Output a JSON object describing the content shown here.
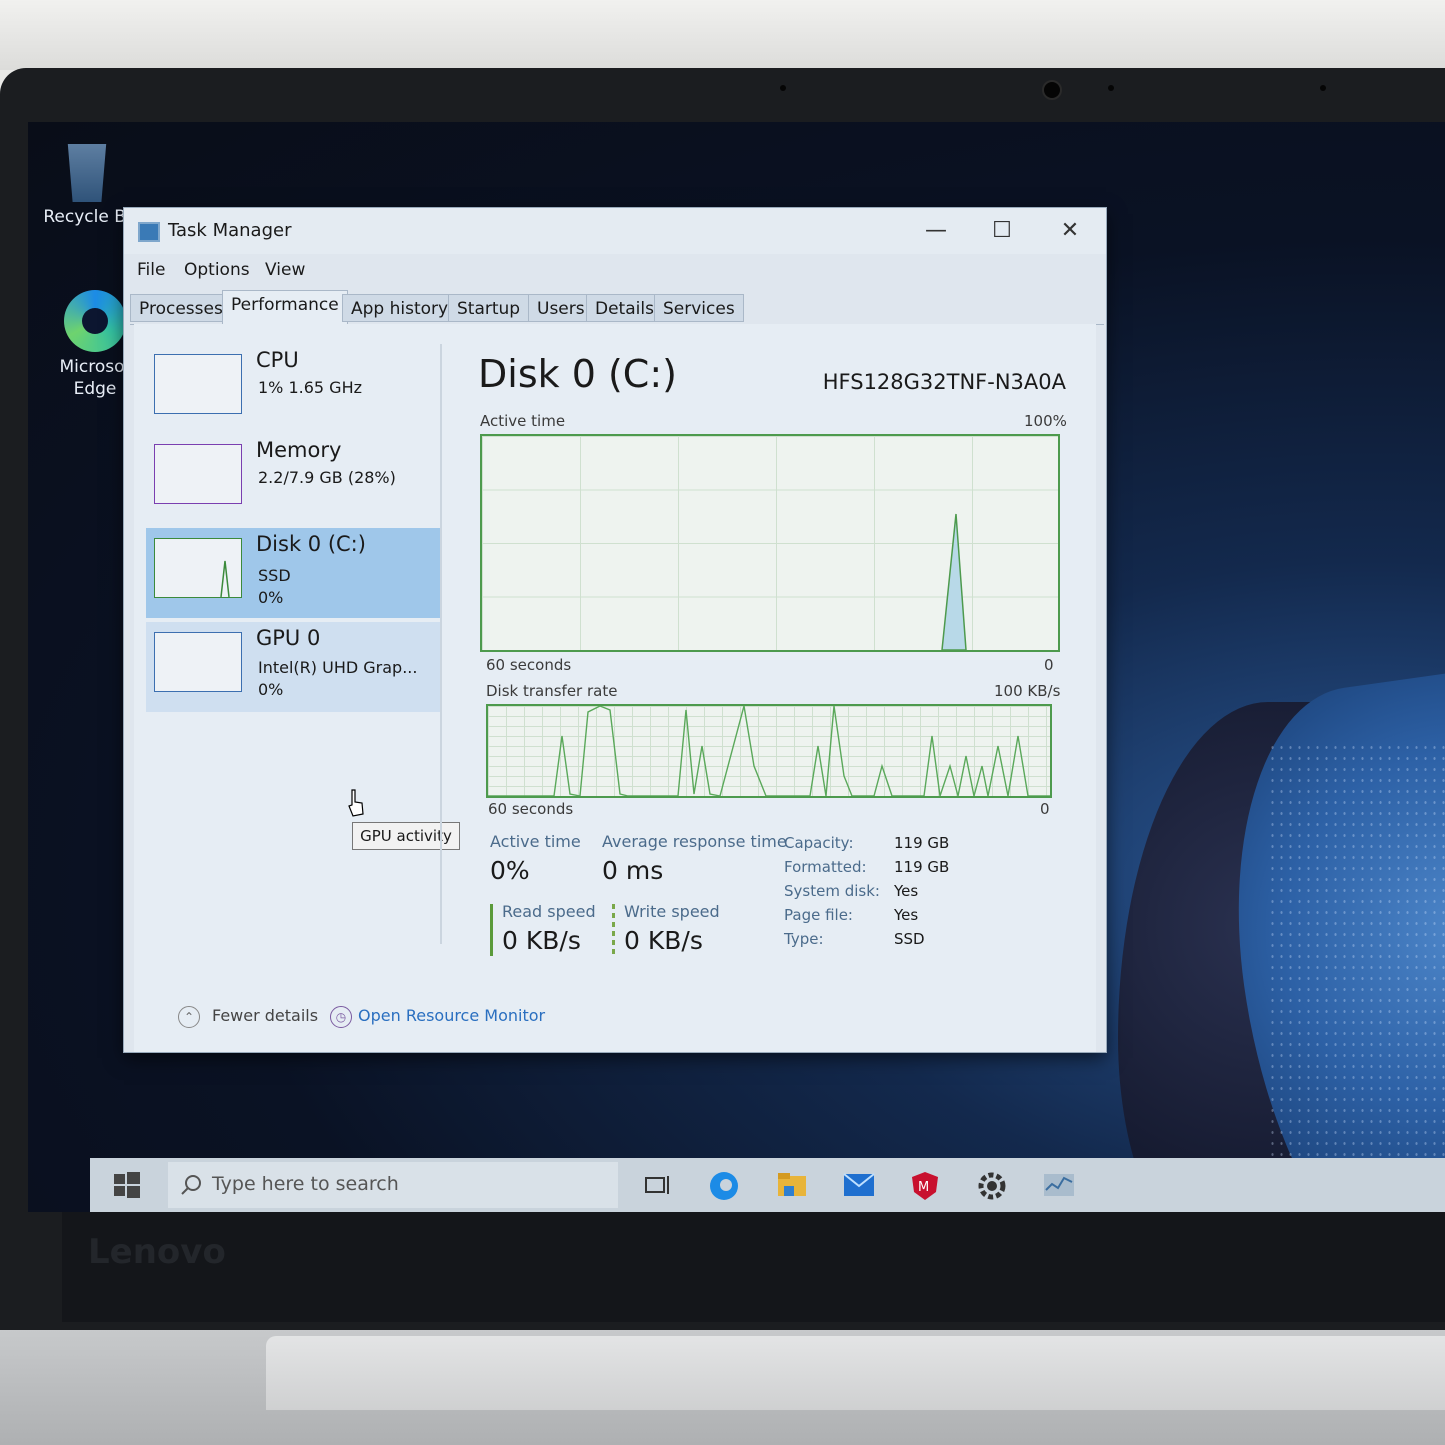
{
  "desktop": {
    "recycle_label": "Recycle Bi",
    "edge_label_line1": "Microsof",
    "edge_label_line2": "Edge"
  },
  "window": {
    "title": "Task Manager",
    "minimize": "—",
    "maximize": "☐",
    "close": "✕"
  },
  "menu": [
    "File",
    "Options",
    "View"
  ],
  "tabs": [
    "Processes",
    "Performance",
    "App history",
    "Startup",
    "Users",
    "Details",
    "Services"
  ],
  "sidebar": {
    "cpu": {
      "name": "CPU",
      "sub": "1%  1.65 GHz"
    },
    "memory": {
      "name": "Memory",
      "sub": "2.2/7.9 GB (28%)"
    },
    "disk": {
      "name": "Disk 0 (C:)",
      "sub1": "SSD",
      "sub2": "0%"
    },
    "gpu": {
      "name": "GPU 0",
      "sub1": "Intel(R) UHD Grap...",
      "sub2": "0%"
    },
    "tooltip": "GPU activity"
  },
  "detail": {
    "title": "Disk 0 (C:)",
    "model": "HFS128G32TNF-N3A0A",
    "active_time_label": "Active time",
    "active_time_max": "100%",
    "seconds_label": "60 seconds",
    "zero": "0",
    "transfer_label": "Disk transfer rate",
    "transfer_max": "100 KB/s",
    "stats": {
      "active_time_label": "Active time",
      "active_time_value": "0%",
      "avg_response_label": "Average response time",
      "avg_response_value": "0 ms",
      "read_label": "Read speed",
      "read_value": "0 KB/s",
      "write_label": "Write speed",
      "write_value": "0 KB/s"
    },
    "props": [
      {
        "k": "Capacity:",
        "v": "119 GB"
      },
      {
        "k": "Formatted:",
        "v": "119 GB"
      },
      {
        "k": "System disk:",
        "v": "Yes"
      },
      {
        "k": "Page file:",
        "v": "Yes"
      },
      {
        "k": "Type:",
        "v": "SSD"
      }
    ]
  },
  "footer": {
    "fewer_details": "Fewer details",
    "resource_monitor": "Open Resource Monitor"
  },
  "taskbar": {
    "search_placeholder": "Type here to search"
  },
  "brand": "Lenovo",
  "colors": {
    "disk_graph": "#4d9a4d",
    "cpu_graph": "#3c6fb0",
    "memory_graph": "#7a3fb0",
    "selected": "#9fc7ea"
  }
}
